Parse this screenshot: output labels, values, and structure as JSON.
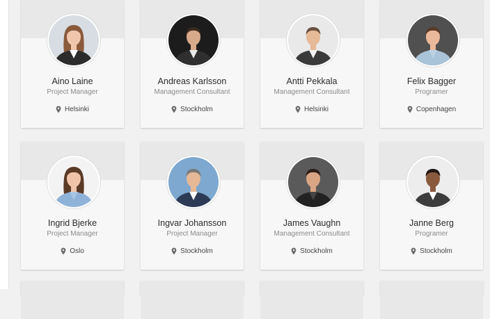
{
  "people": [
    {
      "name": "Aino Laine",
      "role": "Project Manager",
      "location": "Helsinki",
      "avatar": {
        "bg": "#d7dde3",
        "skin": "#f0c7ad",
        "hair": "#8a5a3b",
        "suit": "#2b2b2b",
        "shirt": "#ffffff",
        "long_hair": true
      }
    },
    {
      "name": "Andreas Karlsson",
      "role": "Management Consultant",
      "location": "Stockholm",
      "avatar": {
        "bg": "#1c1c1c",
        "skin": "#d9a98c",
        "hair": "#3a2a20",
        "suit": "#2f2f2f",
        "shirt": "#e9e9e9",
        "long_hair": false
      }
    },
    {
      "name": "Antti Pekkala",
      "role": "Management Consultant",
      "location": "Helsinki",
      "avatar": {
        "bg": "#e9e9e9",
        "skin": "#e6b998",
        "hair": "#6b5240",
        "suit": "#3a3a3a",
        "shirt": "#f2f2f2",
        "long_hair": false
      }
    },
    {
      "name": "Felix Bagger",
      "role": "Programer",
      "location": "Copenhagen",
      "avatar": {
        "bg": "#505050",
        "skin": "#eab99b",
        "hair": "#5a3a26",
        "suit": "#a9c3d8",
        "shirt": "#bcd2e4",
        "long_hair": false
      }
    },
    {
      "name": "Ingrid Bjerke",
      "role": "Project Manager",
      "location": "Oslo",
      "avatar": {
        "bg": "#f3f3f3",
        "skin": "#efc4a8",
        "hair": "#5b3a26",
        "suit": "#8fb3d8",
        "shirt": "#a8c6e3",
        "long_hair": true
      }
    },
    {
      "name": "Ingvar Johansson",
      "role": "Project Manager",
      "location": "Stockholm",
      "avatar": {
        "bg": "#7ea8cf",
        "skin": "#e6b896",
        "hair": "#7a7a7a",
        "suit": "#2d3a55",
        "shirt": "#ffffff",
        "long_hair": false
      }
    },
    {
      "name": "James Vaughn",
      "role": "Management Consultant",
      "location": "Stockholm",
      "avatar": {
        "bg": "#5a5a5a",
        "skin": "#d9a585",
        "hair": "#2e2018",
        "suit": "#222222",
        "shirt": "#444444",
        "long_hair": false
      }
    },
    {
      "name": "Janne Berg",
      "role": "Programer",
      "location": "Stockholm",
      "avatar": {
        "bg": "#ededed",
        "skin": "#8a5a3e",
        "hair": "#1f1612",
        "suit": "#3c3c3c",
        "shirt": "#ffffff",
        "long_hair": false
      }
    }
  ]
}
